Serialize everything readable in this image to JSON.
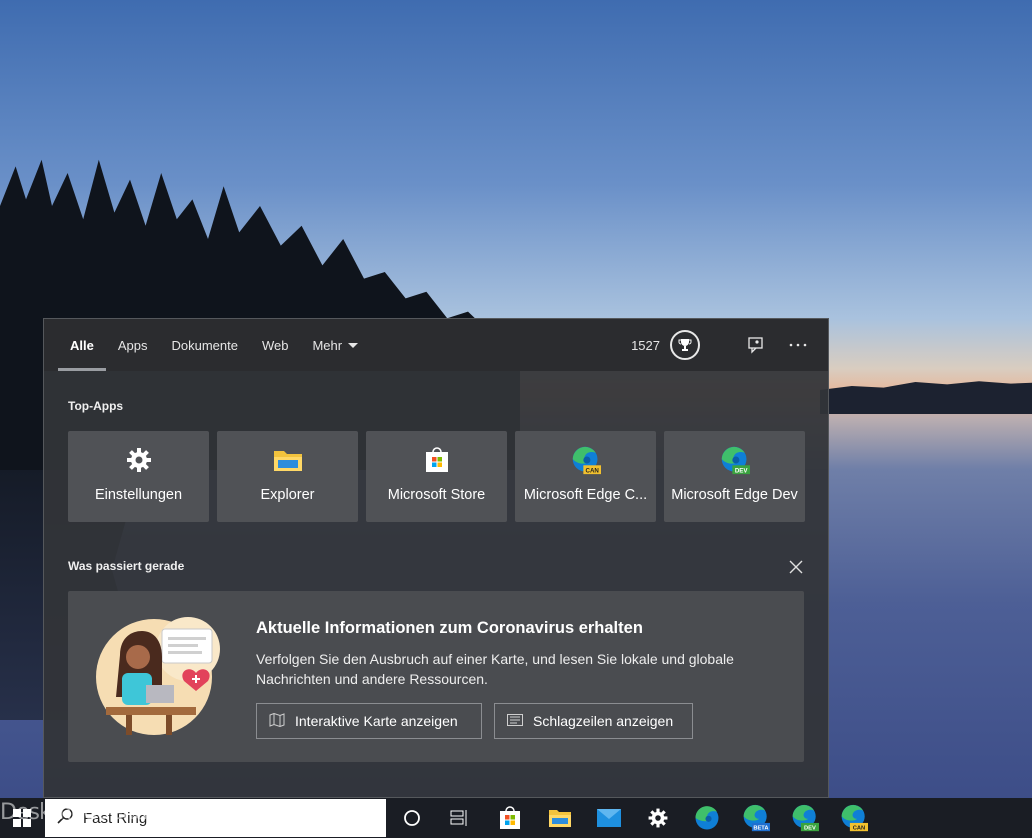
{
  "tabs": [
    {
      "label": "Alle",
      "active": true
    },
    {
      "label": "Apps"
    },
    {
      "label": "Dokumente"
    },
    {
      "label": "Web"
    },
    {
      "label": "Mehr"
    }
  ],
  "header": {
    "points": "1527",
    "trophy_icon": "trophy-icon",
    "feedback_icon": "feedback-icon",
    "more_icon": "more-options-icon"
  },
  "top_apps": {
    "title": "Top-Apps",
    "items": [
      {
        "label": "Einstellungen",
        "icon": "settings-gear-icon"
      },
      {
        "label": "Explorer",
        "icon": "file-explorer-icon"
      },
      {
        "label": "Microsoft Store",
        "icon": "microsoft-store-icon"
      },
      {
        "label": "Microsoft Edge C...",
        "icon": "edge-canary-icon",
        "badge": "CAN"
      },
      {
        "label": "Microsoft Edge Dev",
        "icon": "edge-dev-icon",
        "badge": "DEV"
      }
    ]
  },
  "news": {
    "section_title": "Was passiert gerade",
    "title": "Aktuelle Informationen zum Coronavirus erhalten",
    "description": "Verfolgen Sie den Ausbruch auf einer Karte, und lesen Sie lokale und globale Nachrichten und andere Ressourcen.",
    "map_button": "Interaktive Karte anzeigen",
    "headlines_button": "Schlagzeilen anzeigen"
  },
  "taskbar": {
    "search_value": "Fast Ring",
    "watermark": "Deskmodder.de",
    "badges": {
      "beta": "BETA",
      "dev": "DEV",
      "can": "CAN",
      "can_panel": "CAN",
      "dev_panel": "DEV"
    }
  },
  "colors": {
    "edge_blue": "#0f7fd6",
    "edge_green": "#3fbf6b",
    "badge_can": "#f2c12e",
    "badge_dev": "#3aa33f",
    "panel_bg": "#323438"
  }
}
